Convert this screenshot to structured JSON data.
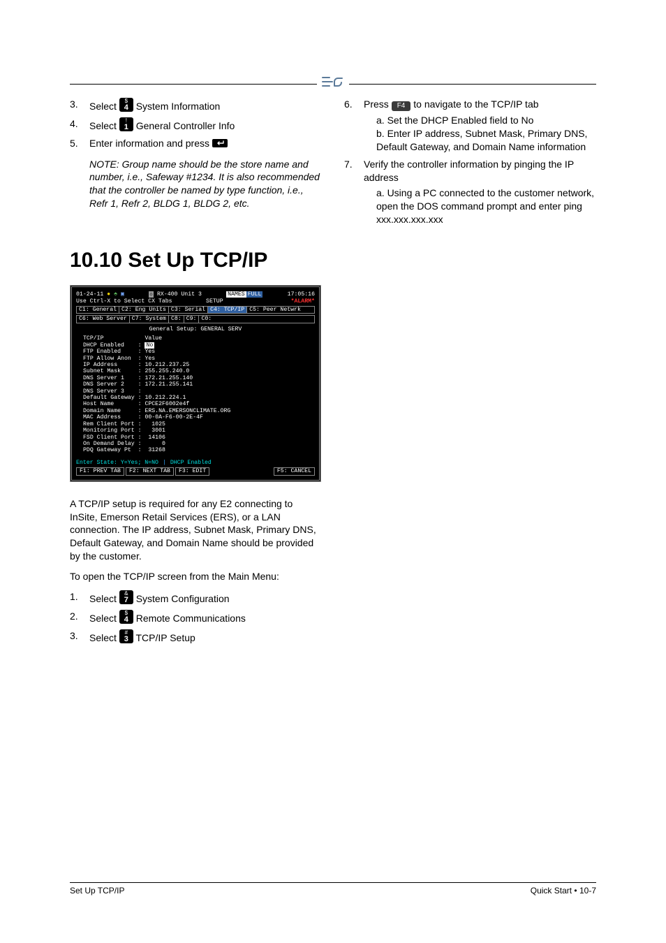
{
  "top_steps": {
    "s3": {
      "num": "3.",
      "pre": "Select ",
      "key_top": "$",
      "key_bot": "4",
      "post": " System Information"
    },
    "s4": {
      "num": "4.",
      "pre": "Select ",
      "key_top": "!",
      "key_bot": "1",
      "post": " General Controller Info"
    },
    "s5": {
      "num": "5.",
      "text": "Enter information and press "
    },
    "note5": "NOTE: Group name should be the store name and number, i.e., Safeway #1234. It is also recommended that the controller be named by type function, i.e., Refr 1, Refr 2, BLDG 1, BLDG 2, etc.",
    "s6": {
      "num": "6.",
      "pre": "Press ",
      "key": "F4",
      "post": " to navigate to the TCP/IP tab"
    },
    "sub_a": "a. Set the DHCP Enabled field to No",
    "sub_b": "b. Enter IP address, Subnet Mask, Primary DNS, Default Gateway, and Domain Name information",
    "s7": {
      "num": "7.",
      "text": "Verify the controller information by pinging the IP address",
      "sub": "a. Using a PC connected to the customer network, open the DOS command prompt and enter ping xxx.xxx.xxx.xxx"
    }
  },
  "section_title": "10.10 Set Up TCP/IP",
  "shot": {
    "date": "01-24-11",
    "unit": " RX-400 Unit 3 ",
    "names": "NAMES",
    "full": "FULL",
    "time": "17:05:16",
    "line2a": "Use Ctrl-X to Select CX Tabs",
    "line2b": "SETUP",
    "alarm": "*ALARM*",
    "tabs1": {
      "c1": "C1: General",
      "c2": "C2: Eng Units",
      "c3": "C3: Serial",
      "c4": "C4: TCP/IP",
      "c5": "C5: Peer Netwrk"
    },
    "tabs2": {
      "c6": "C6: Web Server",
      "c7": "C7: System",
      "c8": "C8:",
      "c9": "C9:",
      "c0": "C0:"
    },
    "panel_title": "General Setup: GENERAL SERV",
    "rows": "TCP/IP            Value\nDHCP Enabled    : \nFTP Enabled     : Yes\nFTP Allow Anon  : Yes\nIP Address      : 10.212.237.25\nSubnet Mask     : 255.255.240.0\nDNS Server 1    : 172.21.255.140\nDNS Server 2    : 172.21.255.141\nDNS Server 3    :\nDefault Gateway : 10.212.224.1\nHost Name       : CPCE2F6002e4f\nDomain Name     : ERS.NA.EMERSONCLIMATE.ORG\nMAC Address     : 00-0A-F6-00-2E-4F\nRem Client Port :   1025\nMonitoring Port :   3001\nFSD Client Port :  14106\nOn Demand Delay :      0\nPDQ Gateway Pt  :  31268",
    "dhcp_sel": "No",
    "help1": "Enter State:  Y=Yes;  N=NO",
    "help2": "DHCP Enabled",
    "fkeys": {
      "f1": "F1: PREV TAB",
      "f2": "F2: NEXT TAB",
      "f3": "F3: EDIT",
      "f5": "F5: CANCEL"
    }
  },
  "after": {
    "p1": "A TCP/IP setup is required for any E2 connecting to InSite, Emerson Retail Services (ERS), or a LAN connection. The IP address, Subnet Mask, Primary DNS, Default Gateway, and Domain Name should be provided by the customer.",
    "p2": "To open the TCP/IP screen from the Main Menu:"
  },
  "after_steps": {
    "s1": {
      "num": "1.",
      "pre": "Select ",
      "key_top": "&",
      "key_bot": "7",
      "post": " System Configuration"
    },
    "s2": {
      "num": "2.",
      "pre": "Select ",
      "key_top": "$",
      "key_bot": "4",
      "post": " Remote Communications"
    },
    "s3": {
      "num": "3.",
      "pre": "Select ",
      "key_top": "#",
      "key_bot": "3",
      "post": " TCP/IP Setup"
    }
  },
  "footer": {
    "left": "Set Up TCP/IP",
    "right": "Quick Start • 10-7"
  }
}
